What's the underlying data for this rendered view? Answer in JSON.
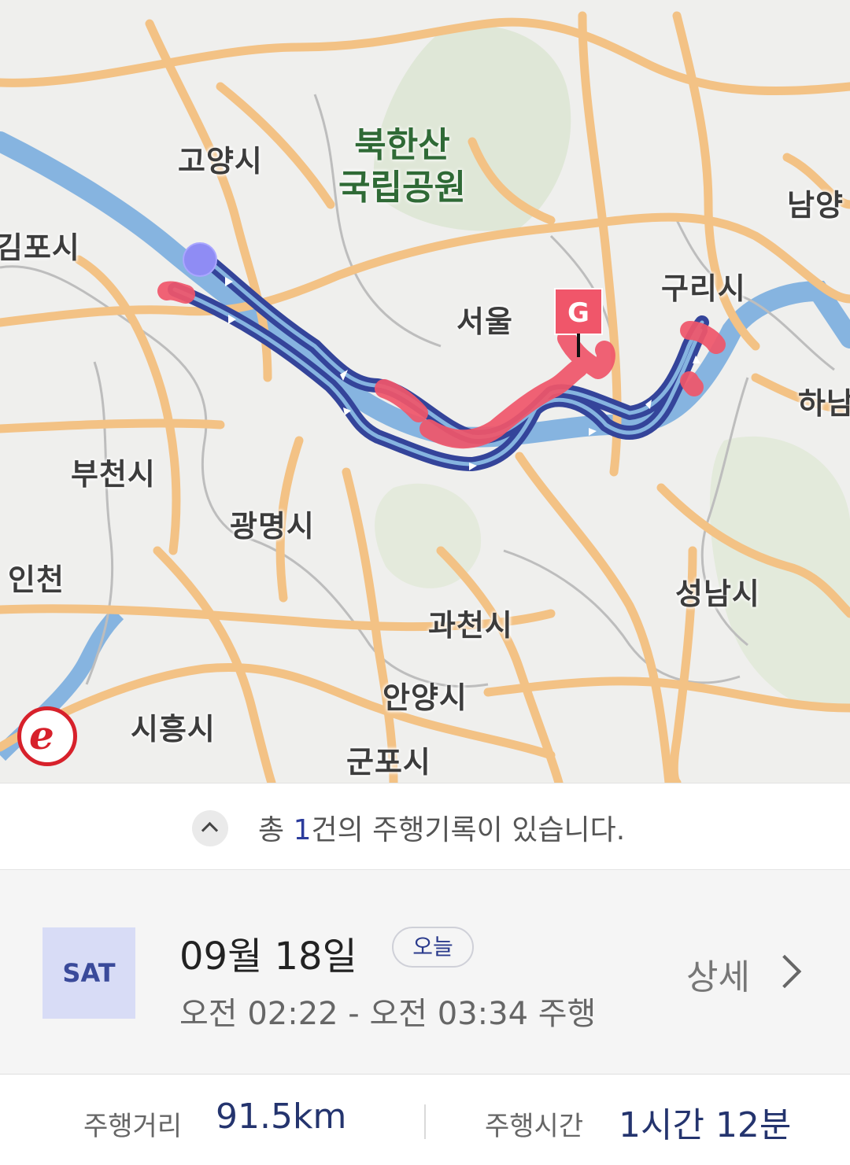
{
  "map": {
    "park_label_line1": "북한산",
    "park_label_line2": "국립공원",
    "goal_marker": "G",
    "labels": {
      "goyang": "고양시",
      "gimpo": "김포시",
      "seoul": "서울",
      "guri": "구리시",
      "namyang": "남양",
      "hanam": "하남",
      "bucheon": "부천시",
      "gwangmyeong": "광명시",
      "incheon": "인천",
      "seongnam": "성남시",
      "gwacheon": "과천시",
      "anyang": "안양시",
      "siheung": "시흥시",
      "gunpo": "군포시"
    },
    "colors": {
      "route_blue": "#34449a",
      "route_red": "#f0566a",
      "river": "#86b4e0",
      "road": "#f3c285",
      "background": "#efefed"
    }
  },
  "summary": {
    "prefix": "총 ",
    "count": "1",
    "suffix": "건의 주행기록이 있습니다."
  },
  "record": {
    "day": "SAT",
    "date": "09월 18일",
    "today_badge": "오늘",
    "time_range": "오전 02:22 - 오전 03:34 주행",
    "detail_label": "상세"
  },
  "stats": {
    "distance_label": "주행거리",
    "distance_value": "91.5km",
    "duration_label": "주행시간",
    "duration_value": "1시간 12분"
  }
}
